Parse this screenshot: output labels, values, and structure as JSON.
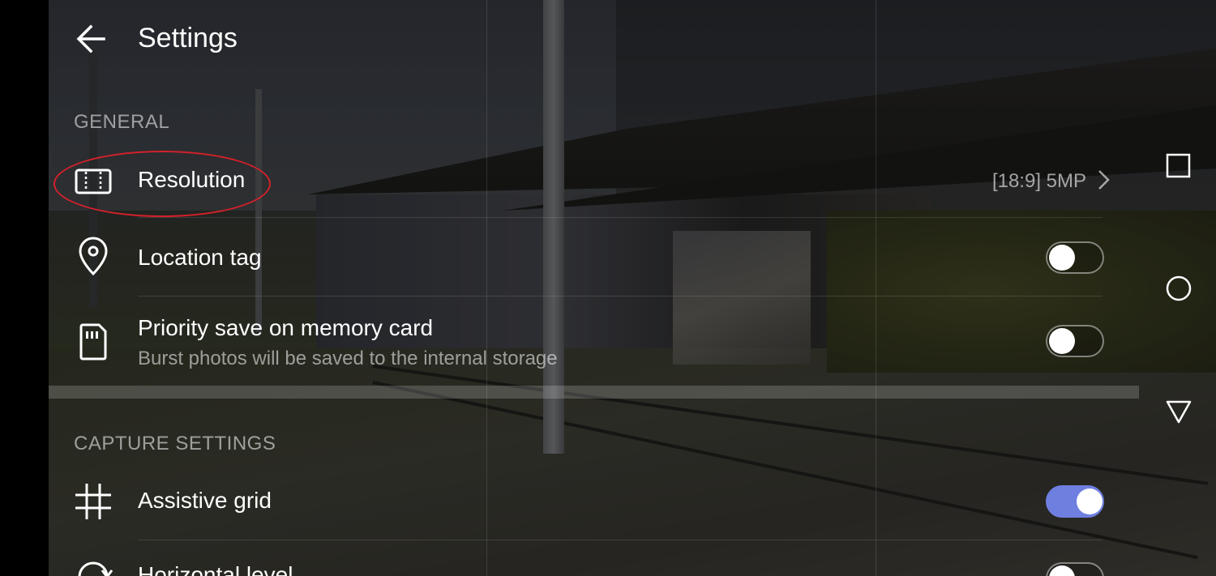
{
  "header": {
    "title": "Settings",
    "back_icon": "arrow-left-icon"
  },
  "sections": {
    "general": "GENERAL",
    "capture": "CAPTURE SETTINGS"
  },
  "rows": {
    "resolution": {
      "label": "Resolution",
      "value": "[18:9] 5MP",
      "icon": "aspect-ratio-icon"
    },
    "location": {
      "label": "Location tag",
      "icon": "location-pin-icon",
      "toggle_on": false
    },
    "priority": {
      "label": "Priority save on memory card",
      "sub": "Burst photos will be saved to the internal storage",
      "icon": "sd-card-icon",
      "toggle_on": false
    },
    "grid": {
      "label": "Assistive grid",
      "icon": "grid-icon",
      "toggle_on": true
    },
    "level": {
      "label": "Horizontal level",
      "icon": "rotate-icon",
      "toggle_on": false
    }
  },
  "nav_controls": [
    "recents-square-icon",
    "home-circle-icon",
    "back-triangle-icon"
  ],
  "colors": {
    "toggle_on": "#6f7fe0",
    "highlight": "#d4212a"
  }
}
